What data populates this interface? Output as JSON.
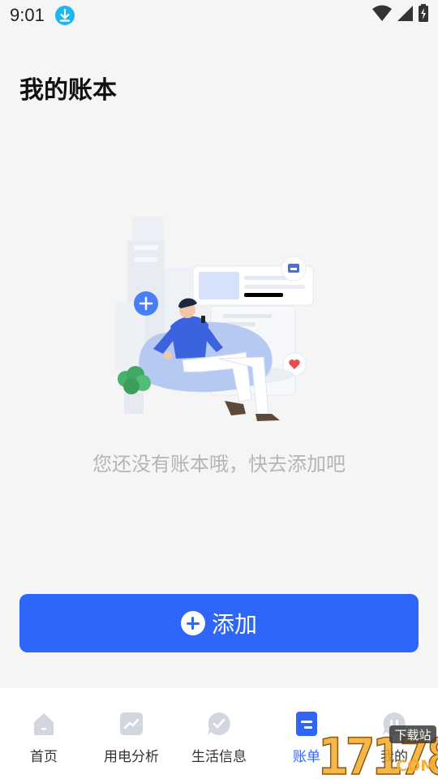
{
  "status_bar": {
    "time": "9:01",
    "icons": [
      "download-icon",
      "wifi-icon",
      "signal-icon",
      "battery-charging-icon"
    ],
    "download_color": "#1fb6ef"
  },
  "page": {
    "title": "我的账本",
    "empty_message": "您还没有账本哦，快去添加吧"
  },
  "add_button": {
    "label": "添加",
    "icon": "plus-circle-icon",
    "color": "#2e67f8"
  },
  "tab_bar": {
    "active_color": "#2e67f8",
    "tabs": [
      {
        "label": "首页",
        "icon": "home-icon"
      },
      {
        "label": "用电分析",
        "icon": "trend-chart-icon"
      },
      {
        "label": "生活信息",
        "icon": "check-bubble-icon"
      },
      {
        "label": "账单",
        "icon": "bill-icon",
        "active": true
      },
      {
        "label": "我的",
        "icon": "profile-icon"
      }
    ]
  },
  "watermark": {
    "site": "17178.COM",
    "tag": "下载站"
  }
}
